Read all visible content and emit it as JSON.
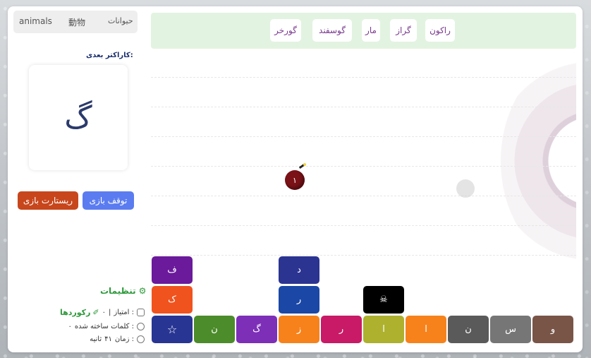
{
  "categories": {
    "english": "animals",
    "chinese": "動物",
    "persian": "حیوانات"
  },
  "next_char": {
    "label": "کاراکتر بعدی:",
    "char": "گ"
  },
  "buttons": {
    "pause": "توقف بازی",
    "restart": "ریستارت بازی"
  },
  "settings_label": "تنظیمات",
  "score": {
    "label": "امتیاز :",
    "value": "۰",
    "separator": "|",
    "records": "رکوردها"
  },
  "words_built": {
    "label": "کلمات ساخته شده :",
    "value": "۰"
  },
  "time": {
    "label": "زمان :",
    "value": "۴۱",
    "unit": "ثانیه"
  },
  "target_words": [
    "راکون",
    "گراز",
    "مار",
    "گوسفند",
    "گورخر"
  ],
  "bomb": {
    "value": "۱"
  },
  "tiles": {
    "row3": [
      "ف",
      "د"
    ],
    "row2": [
      "ک",
      "ر",
      "skull-icon"
    ],
    "row1": [
      "star-icon",
      "ن",
      "گ",
      "ز",
      "ر",
      "ا",
      "ا",
      "ن",
      "س",
      "و"
    ]
  },
  "colors": {
    "tile_purple": "#6a1a9a",
    "tile_navy": "#2b3491",
    "tile_orange_red": "#f0531e",
    "tile_blue": "#1b47a6",
    "tile_black": "#000000",
    "tile_star": "#283593",
    "tile_green": "#4c8c2b",
    "tile_violet": "#7d2fb8",
    "tile_orange": "#f7821b",
    "tile_crimson": "#c81a66",
    "tile_olive": "#adb12e",
    "tile_dark_grey": "#5a5a5a",
    "tile_grey": "#767676",
    "tile_brown": "#795548"
  }
}
